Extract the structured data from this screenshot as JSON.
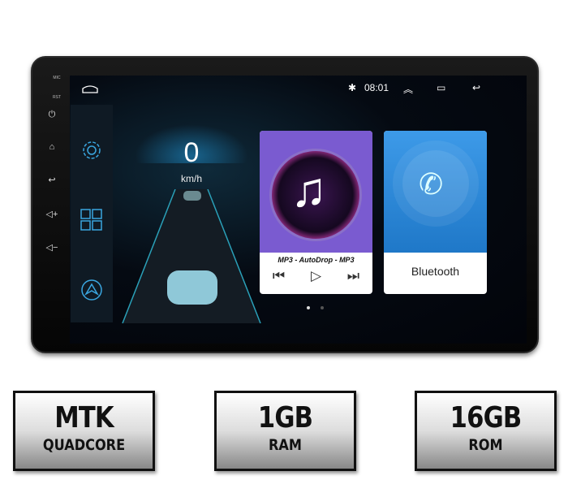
{
  "device": {
    "hardware_labels": {
      "mic": "MIC",
      "rst": "RST"
    },
    "hardware_buttons": [
      "power-icon",
      "home-icon",
      "back-icon",
      "volume-up-icon",
      "volume-down-icon"
    ],
    "status_bar": {
      "time": "08:01",
      "icons": [
        "home-icon",
        "bluetooth-icon",
        "expand-up-icon",
        "recent-apps-icon",
        "back-icon"
      ]
    },
    "sidebar": {
      "items": [
        "settings-icon",
        "apps-grid-icon",
        "navigation-icon"
      ]
    },
    "speed": {
      "value": "0",
      "unit": "km/h"
    },
    "music_card": {
      "title": "MP3 - AutoDrop - MP3",
      "prev": "⏮",
      "play": "▷",
      "next": "⏭"
    },
    "bluetooth_card": {
      "label": "Bluetooth"
    },
    "page_indicator": {
      "pages": 2,
      "current": 1
    },
    "colors": {
      "accent": "#3aa6e0",
      "music_bg": "#7a5bd0",
      "bluetooth_bg": "#2d8ad8"
    }
  },
  "badges": [
    {
      "big": "MTK",
      "sub": "QUADCORE"
    },
    {
      "big": "1GB",
      "sub": "RAM"
    },
    {
      "big": "16GB",
      "sub": "ROM"
    }
  ]
}
